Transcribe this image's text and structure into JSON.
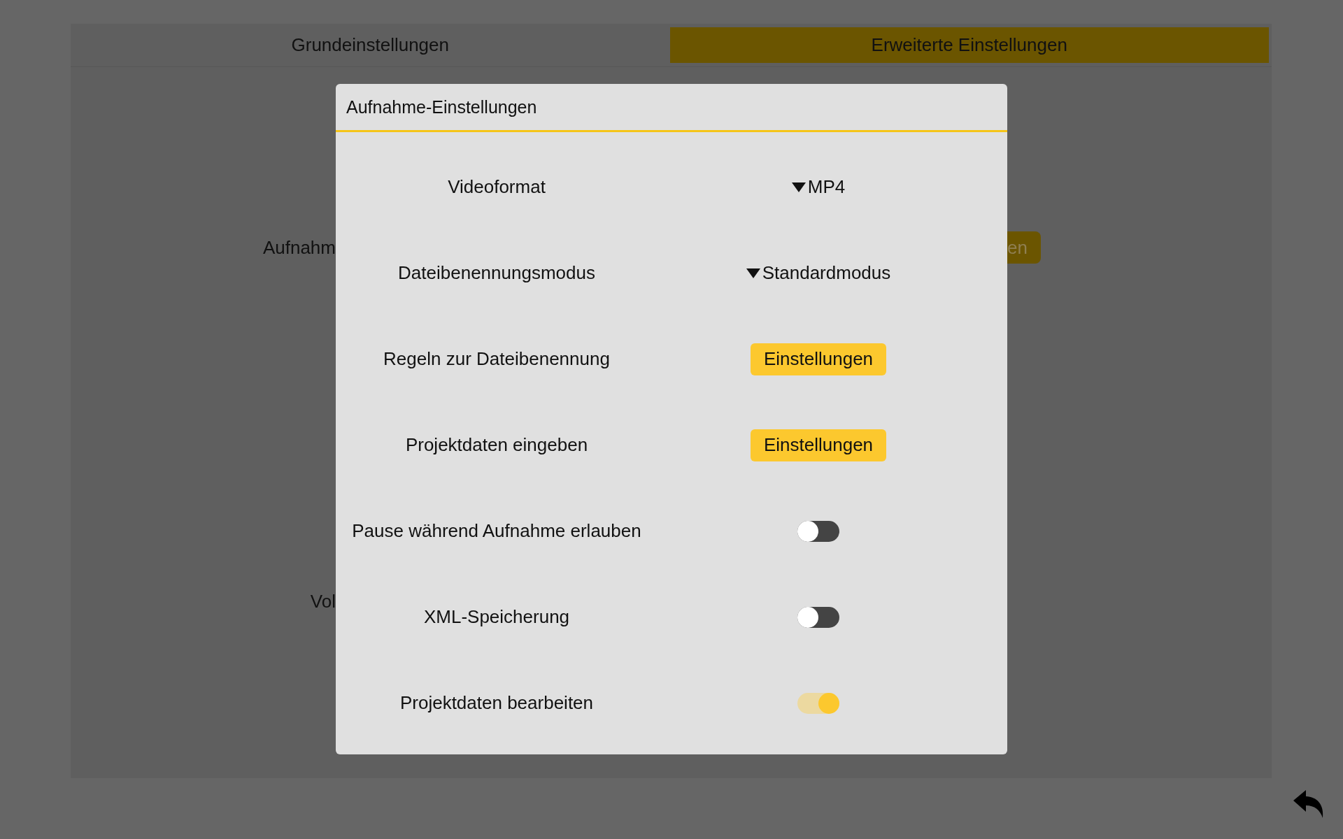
{
  "tabs": [
    {
      "label": "Grundeinstellungen",
      "selected": false
    },
    {
      "label": "Erweiterte Einstellungen",
      "selected": true
    }
  ],
  "background_rows": [
    {
      "label": "Aufnahm",
      "button": "en"
    },
    {
      "label": "Vol"
    }
  ],
  "dialog": {
    "title": "Aufnahme-Einstellungen",
    "rows": [
      {
        "kind": "dropdown",
        "label": "Videoformat",
        "value": "MP4"
      },
      {
        "kind": "dropdown",
        "label": "Dateibenennungsmodus",
        "value": "Standardmodus"
      },
      {
        "kind": "button",
        "label": "Regeln zur Dateibenennung",
        "value": "Einstellungen"
      },
      {
        "kind": "button",
        "label": "Projektdaten eingeben",
        "value": "Einstellungen"
      },
      {
        "kind": "toggle",
        "label": "Pause während Aufnahme erlauben",
        "on": false
      },
      {
        "kind": "toggle",
        "label": "XML-Speicherung",
        "on": false
      },
      {
        "kind": "toggle",
        "label": "Projektdaten bearbeiten",
        "on": true
      }
    ]
  }
}
